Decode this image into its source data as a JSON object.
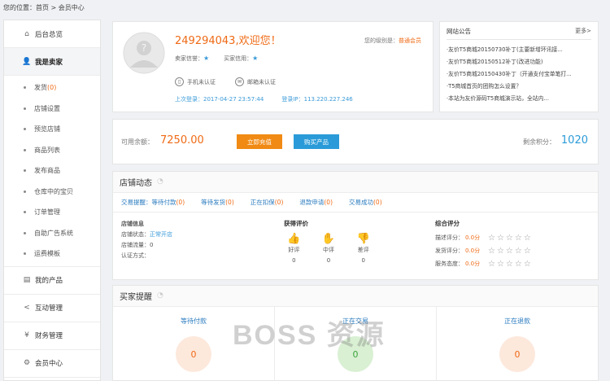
{
  "breadcrumb": {
    "prefix": "您的位置：",
    "home": "首页",
    "sep": ">",
    "current": "会员中心"
  },
  "sidebar": {
    "items": [
      {
        "label": "后台总览",
        "icon": "home-icon"
      },
      {
        "label": "我是卖家",
        "icon": "user-icon"
      },
      {
        "label": "我的产品",
        "icon": "folder-icon"
      },
      {
        "label": "互动管理",
        "icon": "share-icon"
      },
      {
        "label": "财务管理",
        "icon": "yen-icon"
      },
      {
        "label": "会员中心",
        "icon": "gear-icon"
      }
    ],
    "seller_sub": [
      {
        "label": "发货",
        "count": "(0)"
      },
      {
        "label": "店铺设置"
      },
      {
        "label": "预览店铺"
      },
      {
        "label": "商品列表"
      },
      {
        "label": "发布商品"
      },
      {
        "label": "仓库中的宝贝"
      },
      {
        "label": "订单管理"
      },
      {
        "label": "自助广告系统"
      },
      {
        "label": "运费模板"
      }
    ]
  },
  "profile": {
    "username": "249294043,欢迎您！",
    "grade_label": "您的级别是：",
    "grade_value": "普通会员",
    "seller_credit": "卖家信誉：",
    "buyer_credit": "买家信用：",
    "phone": "手机未认证",
    "email": "邮箱未认证",
    "last_login": "上次登录：2017-04-27 23:57:44",
    "login_ip": "登录IP：113.220.227.246"
  },
  "notice": {
    "title": "网站公告",
    "more": "更多>",
    "items": [
      "·友价T5商城20150730补丁(主要新增环讯接...",
      "·友价T5商城20150512补丁(改进功能)",
      "·友价T5商城20150430补丁（开通支付宝单笔打...",
      "·T5商城首页的团购怎么设置？",
      "·本站为友价源码T5商城演示站，全站内..."
    ]
  },
  "balance": {
    "label": "可用余额：",
    "value": "7250.00",
    "charge_btn": "立即充值",
    "buy_btn": "购买产品",
    "points_label": "剩余积分：",
    "points_value": "1020"
  },
  "shop": {
    "title": "店铺动态",
    "tabs": [
      {
        "label": "交易提醒：等待付款",
        "count": "(0)"
      },
      {
        "label": "等待发货",
        "count": "(0)"
      },
      {
        "label": "正在扣保",
        "count": "(0)"
      },
      {
        "label": "退款申请",
        "count": "(0)"
      },
      {
        "label": "交易成功",
        "count": "(0)"
      }
    ],
    "info_title": "店铺信息",
    "status_label": "店铺状态：",
    "status_value": "正常开店",
    "traffic": "店铺流量：0",
    "auth": "认证方式：",
    "rate_title": "获得评价",
    "rates": [
      {
        "label": "好评",
        "count": "0"
      },
      {
        "label": "中评",
        "count": "0"
      },
      {
        "label": "差评",
        "count": "0"
      }
    ],
    "score_title": "综合评分",
    "scores": [
      {
        "label": "描述评分：",
        "value": "0.0分"
      },
      {
        "label": "发货评分：",
        "value": "0.0分"
      },
      {
        "label": "服务态度：",
        "value": "0.0分"
      }
    ]
  },
  "buyer": {
    "title": "买家提醒",
    "cols": [
      {
        "label": "等待付款",
        "value": "0"
      },
      {
        "label": "正在交易",
        "value": "0"
      },
      {
        "label": "正在退款",
        "value": "0"
      }
    ]
  },
  "watermark": "BOSS 资源"
}
